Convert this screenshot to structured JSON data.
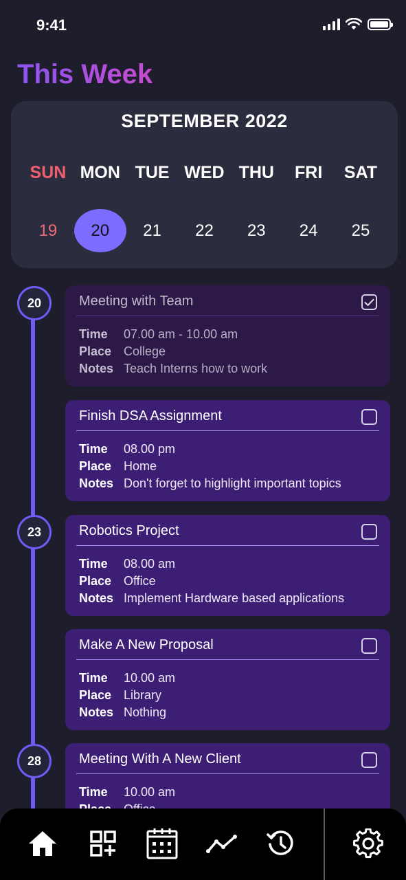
{
  "status": {
    "time": "9:41"
  },
  "page": {
    "title": "This Week"
  },
  "calendar": {
    "month": "SEPTEMBER 2022",
    "weekdays": [
      "SUN",
      "MON",
      "TUE",
      "WED",
      "THU",
      "FRI",
      "SAT"
    ],
    "dates": [
      "19",
      "20",
      "21",
      "22",
      "23",
      "24",
      "25"
    ],
    "selected_date": "20"
  },
  "timeline": {
    "markers": [
      "20",
      "23",
      "28"
    ]
  },
  "labels": {
    "time": "Time",
    "place": "Place",
    "notes": "Notes"
  },
  "tasks": [
    {
      "title": "Meeting with Team",
      "time": "07.00 am - 10.00 am",
      "place": "College",
      "notes": "Teach Interns how to work",
      "checked": true
    },
    {
      "title": "Finish DSA Assignment",
      "time": "08.00 pm",
      "place": "Home",
      "notes": "Don't forget to highlight important topics",
      "checked": false
    },
    {
      "title": "Robotics Project",
      "time": "08.00 am",
      "place": "Office",
      "notes": "Implement Hardware based applications",
      "checked": false
    },
    {
      "title": "Make A New Proposal",
      "time": "10.00 am",
      "place": "Library",
      "notes": "Nothing",
      "checked": false
    },
    {
      "title": "Meeting With A New Client",
      "time": "10.00 am",
      "place": "Office",
      "notes": "",
      "checked": false
    }
  ],
  "nav": {
    "items": [
      "home-icon",
      "add-grid-icon",
      "calendar-icon",
      "stats-icon",
      "history-icon",
      "settings-icon"
    ]
  },
  "colors": {
    "accent": "#7c6cff",
    "sunday": "#ef5f6e",
    "card": "#3c1f75",
    "card_done": "#2d1947",
    "background": "#1d1d2b"
  }
}
